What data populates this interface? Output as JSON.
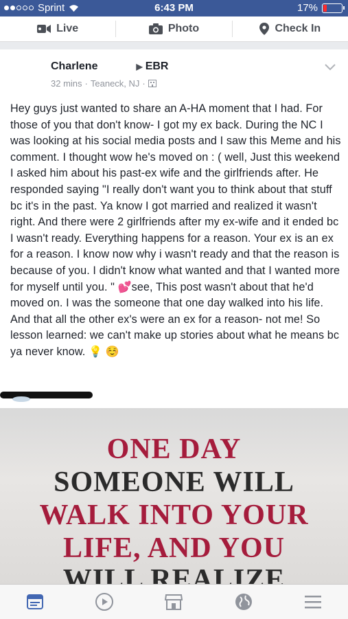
{
  "status_bar": {
    "carrier": "Sprint",
    "time": "6:43 PM",
    "battery": "17%"
  },
  "composer": {
    "live": "Live",
    "photo": "Photo",
    "checkin": "Check In"
  },
  "post": {
    "author": "Charlene",
    "group": "EBR",
    "time": "32 mins",
    "location": "Teaneck, NJ",
    "dot": "·",
    "body_1": "Hey guys just wanted to share an A-HA moment that I had. For those of you that don't know- I got my ex back. During the NC I was looking at his social media posts and I saw this Meme and his comment.  I thought wow he's moved on : ( well, Just this weekend I asked him about his past-ex wife and the girlfriends after.  He responded saying \"I really don't want you to think about that stuff bc it's in the past.  Ya know I got married and realized it wasn't right.  And there were 2 girlfriends after my ex-wife and it ended bc I wasn't ready.  Everything happens for a reason.  Your ex is an ex for a reason.  I know now why i wasn't ready and that the reason is because of you.  I didn't know what wanted and that I wanted more for myself until you. \"",
    "emoji_hearts": "💕",
    "body_2": "see, This post wasn't about that he'd moved on.  I was the someone that one day walked into his life.  And that all the other ex's were an ex for a reason- not me! So lesson learned: we can't make up stories about what he means bc ya never know.",
    "emoji_bulb": "💡",
    "emoji_smile": "☺️"
  },
  "meme": {
    "line1": "ONE DAY",
    "line2": "SOMEONE WILL",
    "line3": "WALK INTO YOUR",
    "line4": "LIFE, AND YOU",
    "line5": "WILL REALIZE"
  },
  "colors": {
    "fb_blue": "#3b5998",
    "meme_red": "#a51c3c",
    "meme_dark": "#2b2b2b",
    "tab_active": "#4267b2"
  }
}
